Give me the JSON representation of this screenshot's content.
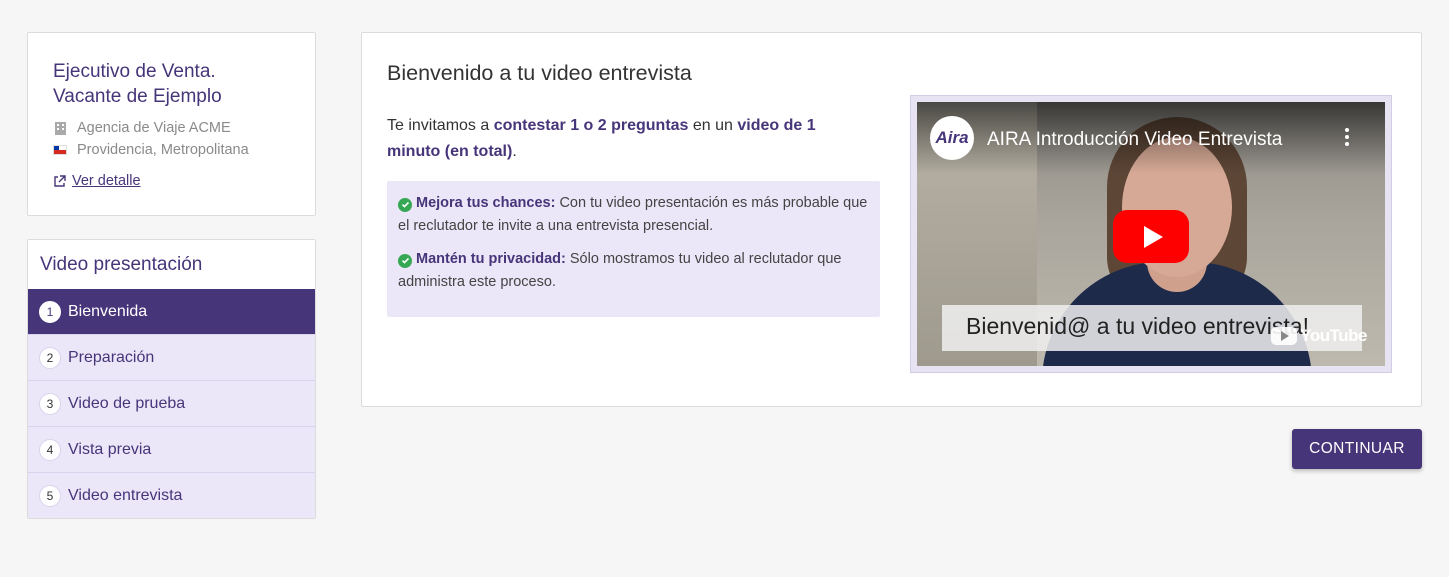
{
  "job": {
    "title": "Ejecutivo de Venta. Vacante de Ejemplo",
    "company": "Agencia de Viaje ACME",
    "location": "Providencia, Metropolitana",
    "detail_link": "Ver detalle"
  },
  "steps": {
    "title": "Video presentación",
    "items": [
      {
        "num": "1",
        "label": "Bienvenida",
        "active": true
      },
      {
        "num": "2",
        "label": "Preparación"
      },
      {
        "num": "3",
        "label": "Video de prueba"
      },
      {
        "num": "4",
        "label": "Vista previa"
      },
      {
        "num": "5",
        "label": "Video entrevista"
      }
    ]
  },
  "main": {
    "title": "Bienvenido a tu video entrevista",
    "intro": {
      "t1": "Te invitamos a ",
      "b1": "contestar 1 o 2 preguntas",
      "t2": " en un ",
      "b2": "video de 1 minuto (en total)",
      "t3": "."
    },
    "tips": [
      {
        "strong": "Mejora tus chances:",
        "text": " Con tu video presentación es más probable que el reclutador te invite a una entrevista presencial."
      },
      {
        "strong": "Mantén tu privacidad:",
        "text": " Sólo mostramos tu video al reclutador que administra este proceso."
      }
    ]
  },
  "video": {
    "channel_logo": "Aira",
    "title": "AIRA Introducción Video Entrevista",
    "caption": "Bienvenid@ a tu video entrevista!",
    "brand": "YouTube"
  },
  "actions": {
    "continue": "CONTINUAR"
  },
  "colors": {
    "brand": "#47357a",
    "step_bg": "#ebe6f8",
    "check": "#36a853"
  }
}
